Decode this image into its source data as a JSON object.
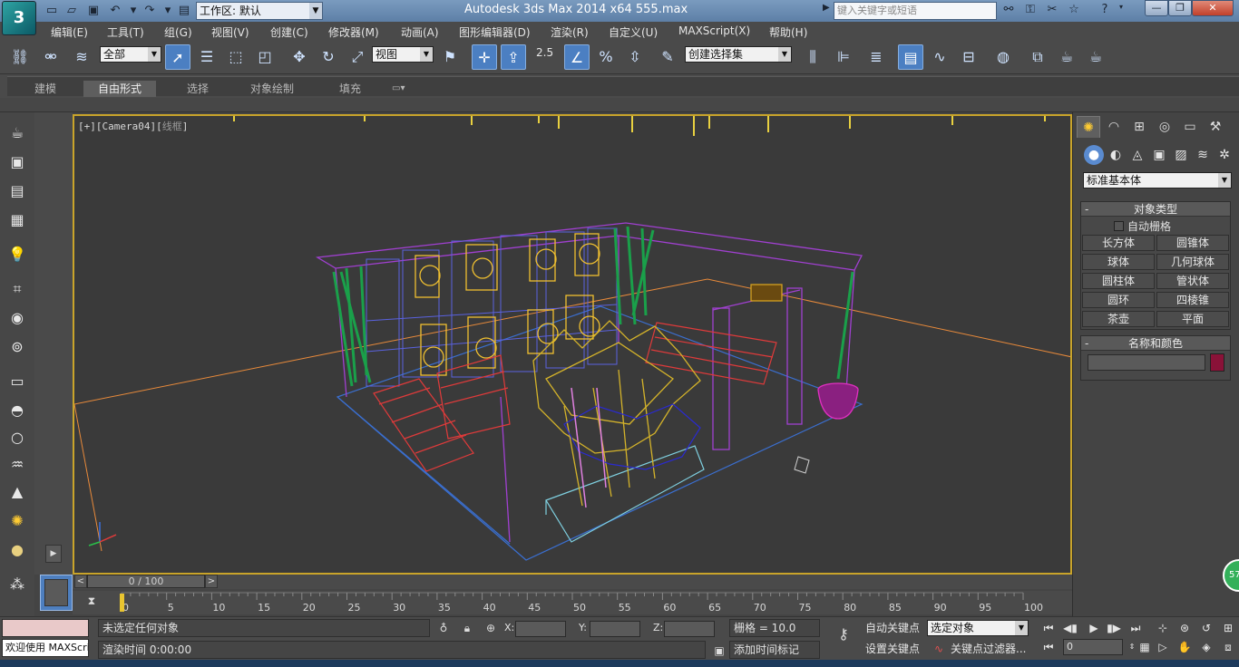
{
  "titlebar": {
    "app_logo": "3",
    "workspace_label": "工作区: 默认",
    "window_title": "Autodesk 3ds Max  2014 x64      555.max",
    "search_placeholder": "键入关键字或短语",
    "win_minimize": "—",
    "win_restore": "❐",
    "win_close": "✕"
  },
  "menu": [
    "编辑(E)",
    "工具(T)",
    "组(G)",
    "视图(V)",
    "创建(C)",
    "修改器(M)",
    "动画(A)",
    "图形编辑器(D)",
    "渲染(R)",
    "自定义(U)",
    "MAXScript(X)",
    "帮助(H)"
  ],
  "toolbar": {
    "selection_filter": "全部",
    "ref_coord": "视图",
    "snap_value": "2.5",
    "named_selection_placeholder": "创建选择集"
  },
  "ribbon": {
    "tabs": [
      "建模",
      "自由形式",
      "选择",
      "对象绘制",
      "填充"
    ],
    "active_tab": "自由形式"
  },
  "viewport": {
    "label_main": "[+][Camera04][",
    "label_shade": "线框",
    "label_end": "]",
    "border_color": "#c9a42a"
  },
  "timeslider": {
    "position_text": "0 / 100",
    "ticks": [
      0,
      5,
      10,
      15,
      20,
      25,
      30,
      35,
      40,
      45,
      50,
      55,
      60,
      65,
      70,
      75,
      80,
      85,
      90,
      95,
      100
    ]
  },
  "command_panel": {
    "category": "标准基本体",
    "object_type": {
      "title": "对象类型",
      "auto_grid": "自动栅格",
      "buttons": [
        "长方体",
        "圆锥体",
        "球体",
        "几何球体",
        "圆柱体",
        "管状体",
        "圆环",
        "四棱锥",
        "茶壶",
        "平面"
      ]
    },
    "name_color": {
      "title": "名称和颜色",
      "swatch_color": "#8a1238"
    },
    "badge": "57"
  },
  "status": {
    "maxscript_text": "欢迎使用 MAXScri",
    "selection_info": "未选定任何对象",
    "render_time": "渲染时间 0:00:00",
    "coord_x": "X:",
    "coord_y": "Y:",
    "coord_z": "Z:",
    "grid": "栅格 = 10.0",
    "add_time_tag": "添加时间标记",
    "auto_key": "自动关键点",
    "set_key": "设置关键点",
    "key_mode": "选定对象",
    "key_filters": "关键点过滤器...",
    "current_frame": "0"
  }
}
